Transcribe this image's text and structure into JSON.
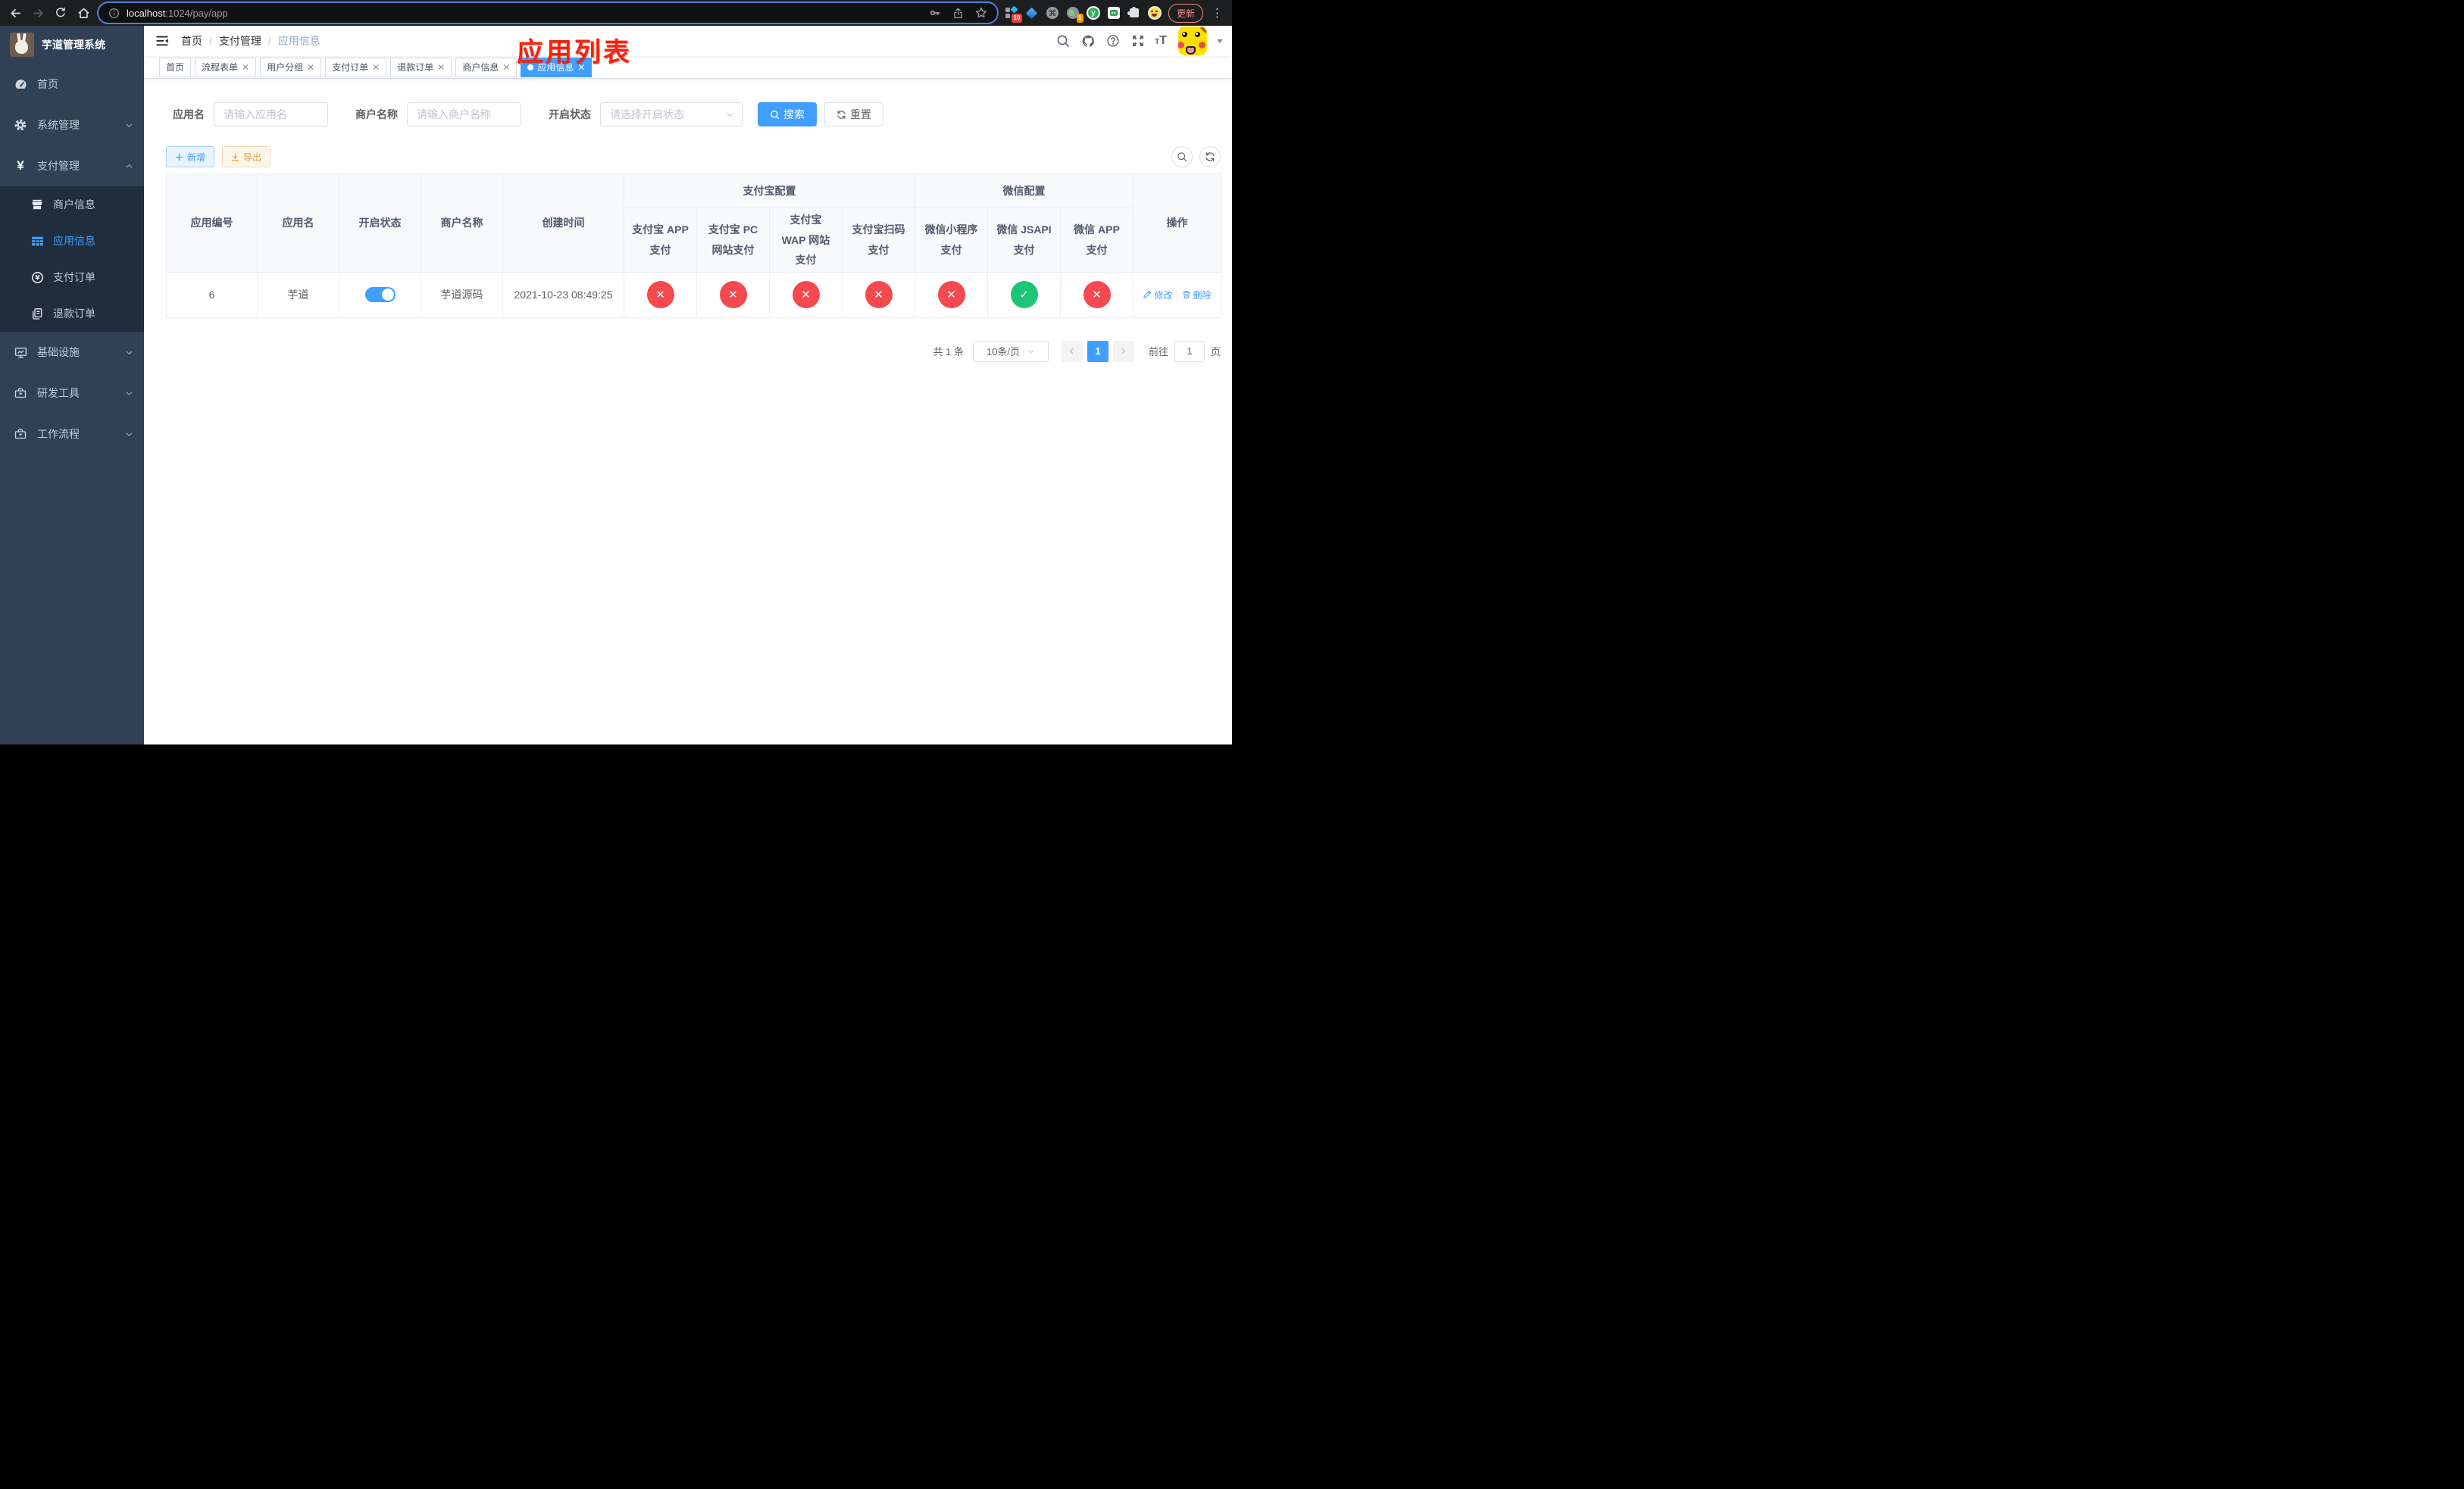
{
  "browser": {
    "url_host": "localhost",
    "url_path": ":1024/pay/app",
    "update_label": "更新",
    "ext_badge_red": "10",
    "ext_badge_orange": "1"
  },
  "sidebar": {
    "title": "芋道管理系统",
    "menu": {
      "home": "首页",
      "system": "系统管理",
      "payment": "支付管理",
      "infra": "基础设施",
      "devtools": "研发工具",
      "workflow": "工作流程"
    },
    "submenu": {
      "merchant": "商户信息",
      "app": "应用信息",
      "pay_order": "支付订单",
      "refund_order": "退款订单"
    }
  },
  "navbar": {
    "breadcrumb": [
      "首页",
      "支付管理",
      "应用信息"
    ],
    "separator": "/"
  },
  "annotation": {
    "text": "应用列表",
    "color": "#f5230c"
  },
  "tabs": [
    {
      "label": "首页"
    },
    {
      "label": "流程表单"
    },
    {
      "label": "用户分组"
    },
    {
      "label": "支付订单"
    },
    {
      "label": "退款订单"
    },
    {
      "label": "商户信息"
    },
    {
      "label": "应用信息"
    }
  ],
  "filters": {
    "app_name_label": "应用名",
    "app_name_placeholder": "请输入应用名",
    "merchant_label": "商户名称",
    "merchant_placeholder": "请输入商户名称",
    "status_label": "开启状态",
    "status_placeholder": "请选择开启状态",
    "search_label": "搜索",
    "reset_label": "重置"
  },
  "toolbar": {
    "add_label": "新增",
    "export_label": "导出"
  },
  "table": {
    "headers": {
      "app_id": "应用编号",
      "app_name": "应用名",
      "status": "开启状态",
      "merchant": "商户名称",
      "created": "创建时间",
      "alipay_group": "支付宝配置",
      "wechat_group": "微信配置",
      "alipay_app": "支付宝 APP 支付",
      "alipay_pc": "支付宝 PC 网站支付",
      "alipay_wap": "支付宝 WAP 网站支付",
      "alipay_qr": "支付宝扫码支付",
      "wx_mini": "微信小程序支付",
      "wx_jsapi": "微信 JSAPI 支付",
      "wx_app": "微信 APP 支付",
      "actions": "操作"
    },
    "row": {
      "app_id": "6",
      "app_name": "芋道",
      "status_on": true,
      "merchant": "芋道源码",
      "created": "2021-10-23 08:49:25",
      "channels": [
        false,
        false,
        false,
        false,
        false,
        true,
        false
      ]
    },
    "actions": {
      "edit": "修改",
      "delete": "删除"
    }
  },
  "pagination": {
    "total": "共 1 条",
    "page_size": "10条/页",
    "current_page": "1",
    "goto_prefix": "前往",
    "goto_value": "1",
    "goto_suffix": "页"
  },
  "colors": {
    "accent": "#409eff",
    "success": "#1cc674",
    "danger": "#f4494e",
    "sidebar_bg": "#304156",
    "sidebar_submenu_bg": "#1f2d3d"
  }
}
